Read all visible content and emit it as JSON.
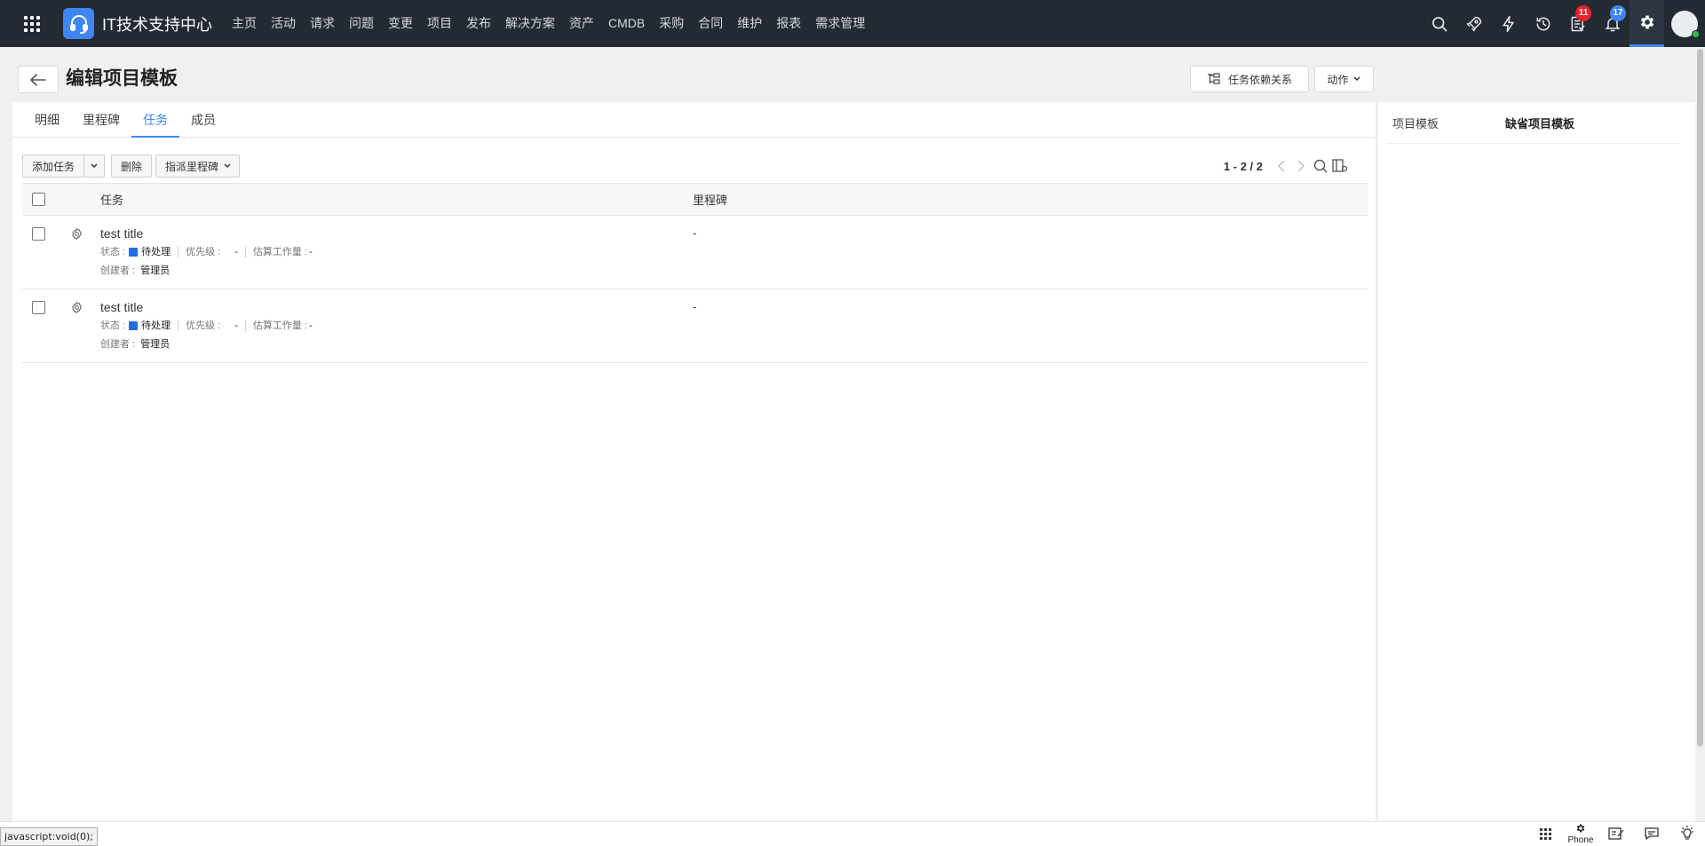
{
  "app": {
    "title": "IT技术支持中心"
  },
  "nav": {
    "items": [
      "主页",
      "活动",
      "请求",
      "问题",
      "变更",
      "项目",
      "发布",
      "解决方案",
      "资产",
      "CMDB",
      "采购",
      "合同",
      "维护",
      "报表",
      "需求管理"
    ]
  },
  "topbar": {
    "tasks_badge": "11",
    "notifications_badge": "17",
    "icons": [
      "search-icon",
      "rocket-icon",
      "lightning-icon",
      "history-icon",
      "task-list-icon",
      "bell-icon",
      "gear-icon",
      "avatar"
    ]
  },
  "header": {
    "title": "编辑项目模板",
    "dependency_button": "任务依赖关系",
    "action_button": "动作"
  },
  "tabs": [
    "明细",
    "里程碑",
    "任务",
    "成员"
  ],
  "active_tab": "任务",
  "toolbar": {
    "add_task": "添加任务",
    "delete": "删除",
    "assign_milestone": "指派里程碑"
  },
  "pager": {
    "text": "1 - 2 / 2"
  },
  "grid": {
    "columns": [
      "任务",
      "里程碑"
    ],
    "rows": [
      {
        "title": "test title",
        "status_label": "状态 :",
        "status_value": "待处理",
        "priority_label": "优先级 :",
        "priority_value": "-",
        "effort_label": "估算工作量 :",
        "effort_value": "-",
        "creator_label": "创建者 :",
        "creator_value": "管理员",
        "milestone": "-"
      },
      {
        "title": "test title",
        "status_label": "状态 :",
        "status_value": "待处理",
        "priority_label": "优先级 :",
        "priority_value": "-",
        "effort_label": "估算工作量 :",
        "effort_value": "-",
        "creator_label": "创建者 :",
        "creator_value": "管理员",
        "milestone": "-"
      }
    ]
  },
  "right_panel": {
    "label": "项目模板",
    "value": "缺省项目模板"
  },
  "statusbar": {
    "url_tip": "javascript:void(0);",
    "phone_label": "Phone"
  },
  "colors": {
    "topbar": "#232a33",
    "accent": "#3e86f5",
    "status_pending": "#1f6fe0",
    "badge_red": "#e8222b"
  }
}
